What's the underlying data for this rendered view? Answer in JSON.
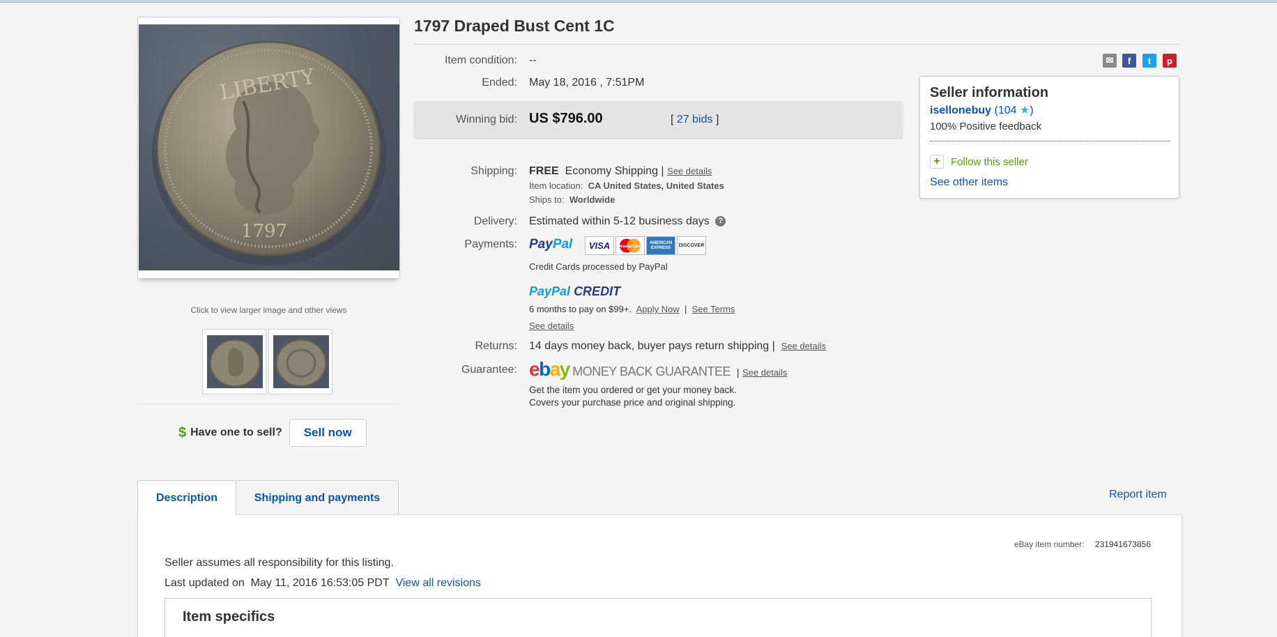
{
  "listing": {
    "title": "1797 Draped Bust Cent 1C",
    "image_caption": "Click to view larger image and other views",
    "coin_legend": "LIBERTY",
    "coin_year": "1797"
  },
  "sell": {
    "dollar_icon": "$",
    "question": "Have one to sell?",
    "button": "Sell now"
  },
  "details": {
    "condition_label": "Item condition:",
    "condition_value": "--",
    "ended_label": "Ended:",
    "ended_value": "May 18, 2016 , 7:51PM",
    "bid_label": "Winning bid:",
    "bid_value": "US $796.00",
    "bids_open": "[",
    "bids_link": "27 bids",
    "bids_close": "]",
    "shipping_label": "Shipping:",
    "shipping_free": "FREE",
    "shipping_method": "Economy Shipping |",
    "shipping_see": "See details",
    "location_label": "Item location:",
    "location_value": "CA United States, United States",
    "ships_to_label": "Ships to:",
    "ships_to_value": "Worldwide",
    "delivery_label": "Delivery:",
    "delivery_value": "Estimated within 5-12 business days",
    "payments_label": "Payments:",
    "paypal_p1": "Pay",
    "paypal_p2": "Pal",
    "cards": [
      "VISA",
      "MasterCard",
      "AMERICAN EXPRESS",
      "DISCOVER"
    ],
    "cc_note": "Credit Cards processed by PayPal",
    "ppcredit_a": "PayPal",
    "ppcredit_b": "CREDIT",
    "credit_terms": "6 months to pay on $99+.",
    "apply_now": "Apply Now",
    "sep": "|",
    "see_terms": "See Terms",
    "credit_see": "See details",
    "returns_label": "Returns:",
    "returns_value": "14 days money back, buyer pays return shipping |",
    "returns_see": "See details",
    "guarantee_label": "Guarantee:",
    "ebay_e": "e",
    "ebay_b": "b",
    "ebay_a": "a",
    "ebay_y": "y",
    "mbg": "MONEY BACK GUARANTEE",
    "guarantee_sep": "|",
    "guarantee_see": "See details",
    "guarantee_line1": "Get the item you ordered or get your money back.",
    "guarantee_line2": "Covers your purchase price and original shipping."
  },
  "share": {
    "email": "✉",
    "facebook": "f",
    "twitter": "t",
    "pinterest": "p"
  },
  "seller": {
    "heading": "Seller information",
    "username": "isellonebuy",
    "score_open": "(",
    "score": "104",
    "score_close": ")",
    "feedback": "100% Positive feedback",
    "follow_icon": "+",
    "follow": "Follow this seller",
    "other_items": "See other items"
  },
  "tabs": {
    "description": "Description",
    "shipping": "Shipping and payments",
    "report": "Report item"
  },
  "description": {
    "item_number_label": "eBay item number:",
    "item_number": "231941673856",
    "responsibility": "Seller assumes all responsibility for this listing.",
    "updated_label": "Last updated on",
    "updated_value": "May 11, 2016 16:53:05 PDT",
    "revisions": "View all revisions",
    "specifics_heading": "Item specifics"
  },
  "colors": {
    "link": "#0654ba",
    "follow_green": "#5aa000",
    "bid_box": "#e4e4e4",
    "ebay_red": "#e53238",
    "ebay_blue": "#0064d2",
    "ebay_yellow": "#f5af02",
    "ebay_green": "#86b817"
  }
}
